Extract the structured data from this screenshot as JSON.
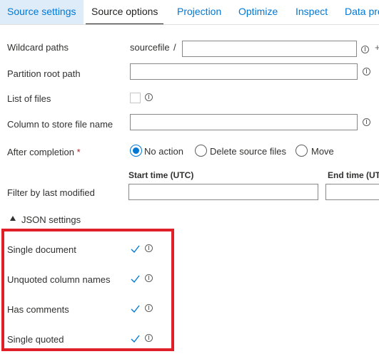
{
  "tabs": [
    {
      "label": "Source settings"
    },
    {
      "label": "Source options"
    },
    {
      "label": "Projection"
    },
    {
      "label": "Optimize"
    },
    {
      "label": "Inspect"
    },
    {
      "label": "Data pre"
    }
  ],
  "fields": {
    "wildcard_paths": {
      "label": "Wildcard paths",
      "prefix": "sourcefile",
      "separator": "/",
      "value": ""
    },
    "partition_root_path": {
      "label": "Partition root path",
      "value": ""
    },
    "list_of_files": {
      "label": "List of files",
      "checked": false
    },
    "column_to_store_file_name": {
      "label": "Column to store file name",
      "value": ""
    },
    "after_completion": {
      "label": "After completion",
      "required_marker": "*",
      "options": [
        "No action",
        "Delete source files",
        "Move"
      ],
      "selected": "No action"
    },
    "filter_by_last_modified": {
      "label": "Filter by last modified",
      "start_label": "Start time (UTC)",
      "end_label": "End time (UTC",
      "start_value": "",
      "end_value": ""
    }
  },
  "json_settings": {
    "header": "JSON settings",
    "expanded": true,
    "options": [
      {
        "label": "Single document",
        "checked": true
      },
      {
        "label": "Unquoted column names",
        "checked": true
      },
      {
        "label": "Has comments",
        "checked": true
      },
      {
        "label": "Single quoted",
        "checked": true
      }
    ]
  },
  "colors": {
    "accent": "#0078d4",
    "highlight": "#e02028",
    "required": "#a4262c"
  },
  "icons": {
    "info": "info-icon",
    "check": "checkmark-icon",
    "expand": "triangle-down-icon"
  }
}
